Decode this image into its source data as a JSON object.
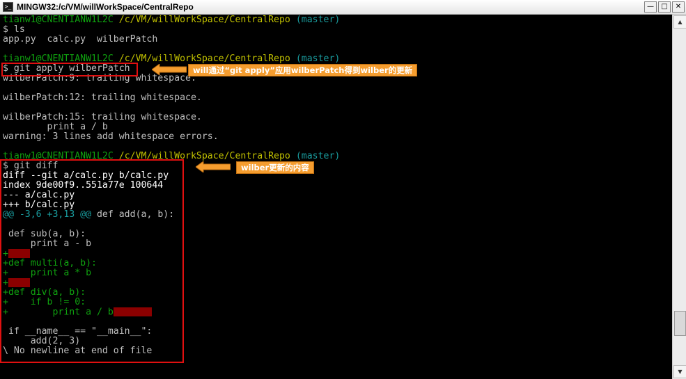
{
  "window": {
    "title": "MINGW32:/c/VM/willWorkSpace/CentralRepo",
    "minimize": "—",
    "maximize": "□",
    "close": "✕"
  },
  "terminal": {
    "prompt1_user": "tianw1@CNENTIANW1L2C",
    "prompt1_path": "/c/VM/willWorkSpace/CentralRepo",
    "prompt1_branch": "(master)",
    "cmd_ls": "$ ls",
    "ls_output": "app.py  calc.py  wilberPatch",
    "prompt2_user": "tianw1@CNENTIANW1L2C",
    "prompt2_path": "/c/VM/willWorkSpace/CentralRepo",
    "prompt2_branch": "(master)",
    "cmd_apply": "$ git apply wilberPatch",
    "warn1": "wilberPatch:9: trailing whitespace.",
    "warn2": "wilberPatch:12: trailing whitespace.",
    "warn3": "wilberPatch:15: trailing whitespace.",
    "warn3_code": "        print a / b",
    "warn_summary": "warning: 3 lines add whitespace errors.",
    "prompt3_user": "tianw1@CNENTIANW1L2C",
    "prompt3_path": "/c/VM/willWorkSpace/CentralRepo",
    "prompt3_branch": "(master)",
    "cmd_diff": "$ git diff",
    "diff_header": "diff --git a/calc.py b/calc.py",
    "diff_index": "index 9de00f9..551a77e 100644",
    "diff_minus": "--- a/calc.py",
    "diff_plus": "+++ b/calc.py",
    "hunk_range": "@@ -3,6 +3,13 @@",
    "hunk_context": " def add(a, b):",
    "l_blank1": "",
    "l_sub": " def sub(a, b):",
    "l_sub_body": "     print a - b",
    "l_add1": "+",
    "l_multi": "+def multi(a, b):",
    "l_multi_body": "+    print a * b",
    "l_add2": "+",
    "l_div": "+def div(a, b):",
    "l_if": "+    if b != 0:",
    "l_div_body": "+        print a / b",
    "l_blank2": "",
    "l_main": " if __name__ == \"__main__\":",
    "l_call": "     add(2, 3)",
    "l_nonewline": "\\ No newline at end of file"
  },
  "annotations": {
    "callout_apply": "will通过“git apply”应用wilberPatch得到wilber的更新",
    "callout_diff": "wilber更新的内容"
  },
  "colors": {
    "annotation_box": "#e01010",
    "callout_fill": "#f59d2f",
    "prompt_green": "#0fa20f",
    "path_olive": "#c0c000",
    "hunk_cyan": "#1a9ea0",
    "whitespace_error": "#8b0000"
  }
}
